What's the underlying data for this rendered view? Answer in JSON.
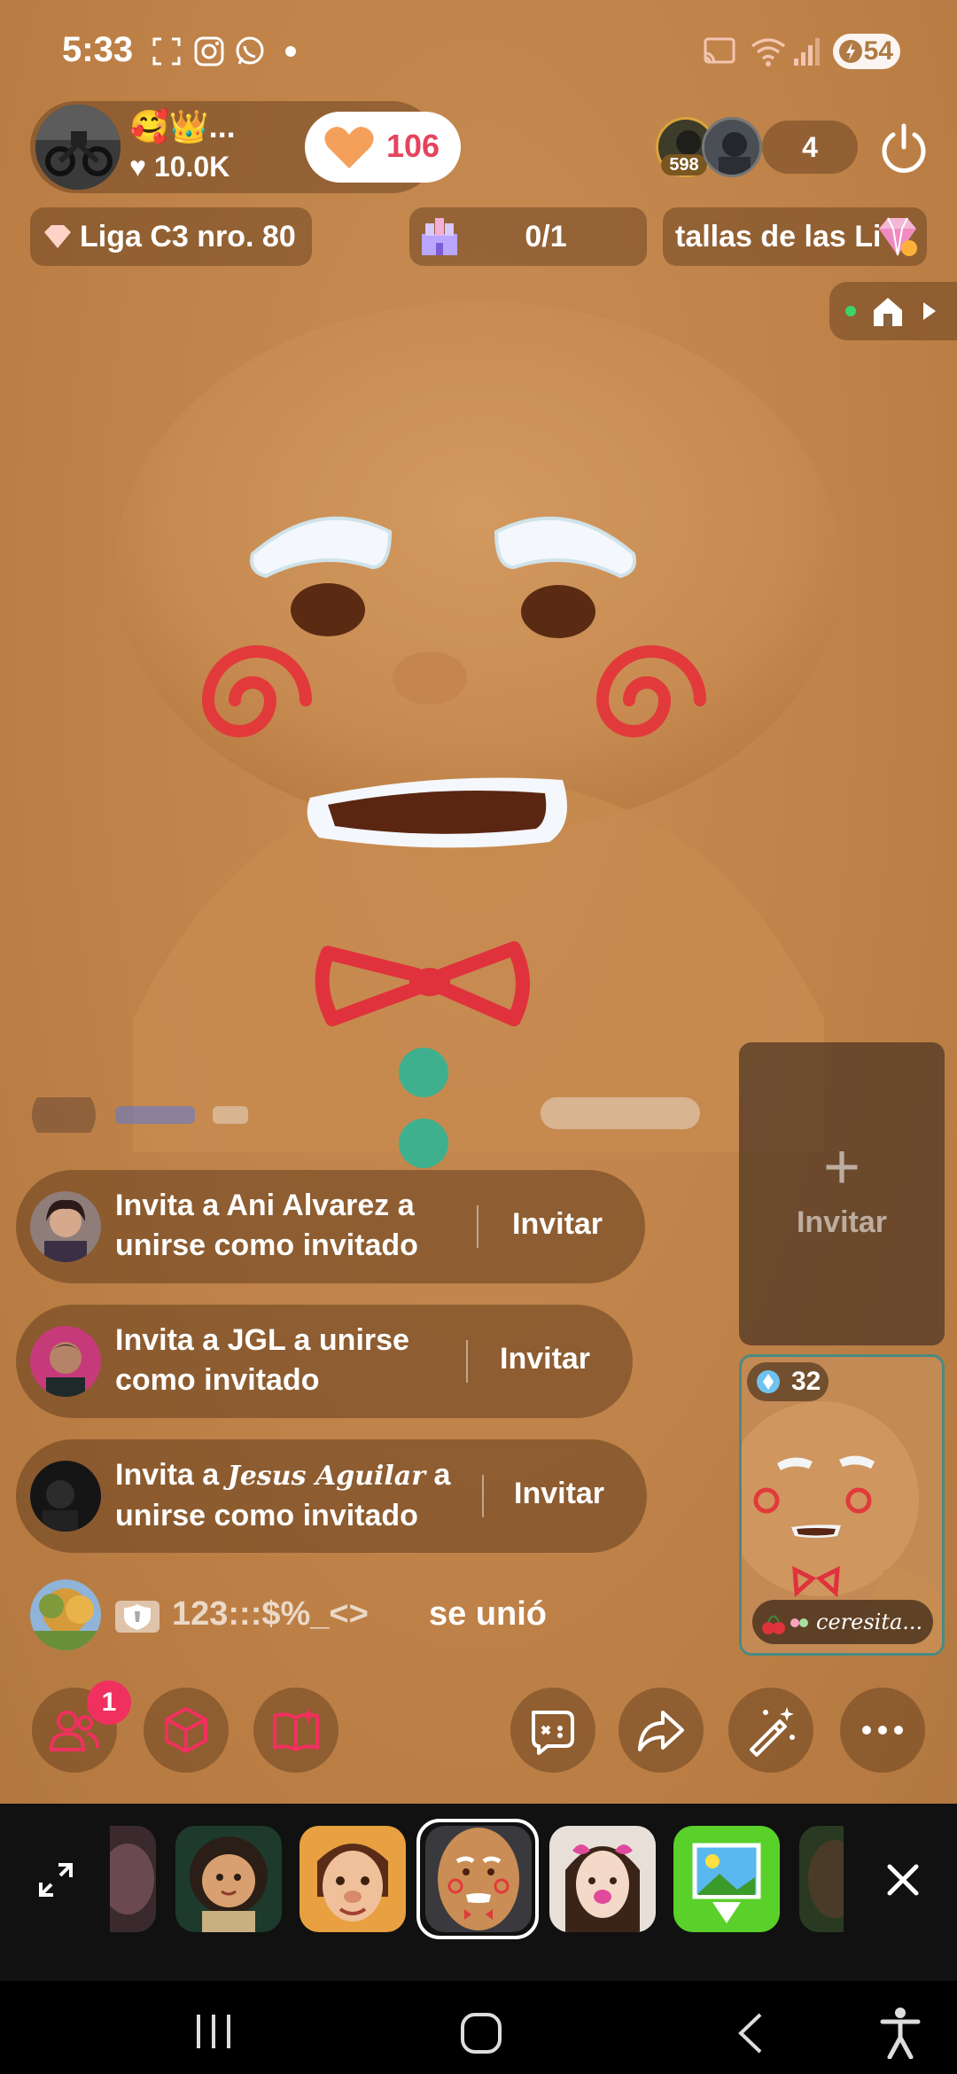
{
  "status_bar": {
    "time": "5:33",
    "battery": "54"
  },
  "host": {
    "name": "🥰👑...",
    "likes": "♥ 10.0K",
    "follow_count": "106"
  },
  "viewers": {
    "badge_count": "598",
    "total": "4"
  },
  "pills": {
    "league": "Liga C3 nro. 80",
    "progress": "0/1",
    "battle": "tallas de las Li"
  },
  "invites": [
    {
      "line1": "Invita a Ani Alvarez a",
      "line2": "unirse como invitado",
      "button": "Invitar"
    },
    {
      "line1": "Invita a JGL a unirse",
      "line2": "como invitado",
      "button": "Invitar"
    },
    {
      "prefix": "Invita a",
      "name": "Jesus Aguilar",
      "suffix": "a",
      "line2": "unirse como invitado",
      "button": "Invitar"
    }
  ],
  "joined": {
    "name": "123:::$%_<>",
    "action": "se unió"
  },
  "guest_slot": {
    "plus": "+",
    "label": "Invitar"
  },
  "guest_preview": {
    "count": "32",
    "name": "ceresita..."
  },
  "notification_count": "1",
  "icons": {
    "accent": "#f0305e",
    "action_icons": [
      "people-icon",
      "cube-icon",
      "book-sparkle-icon",
      "game-controller-icon",
      "share-arrow-icon",
      "magic-wand-icon",
      "more-dots-icon"
    ]
  }
}
